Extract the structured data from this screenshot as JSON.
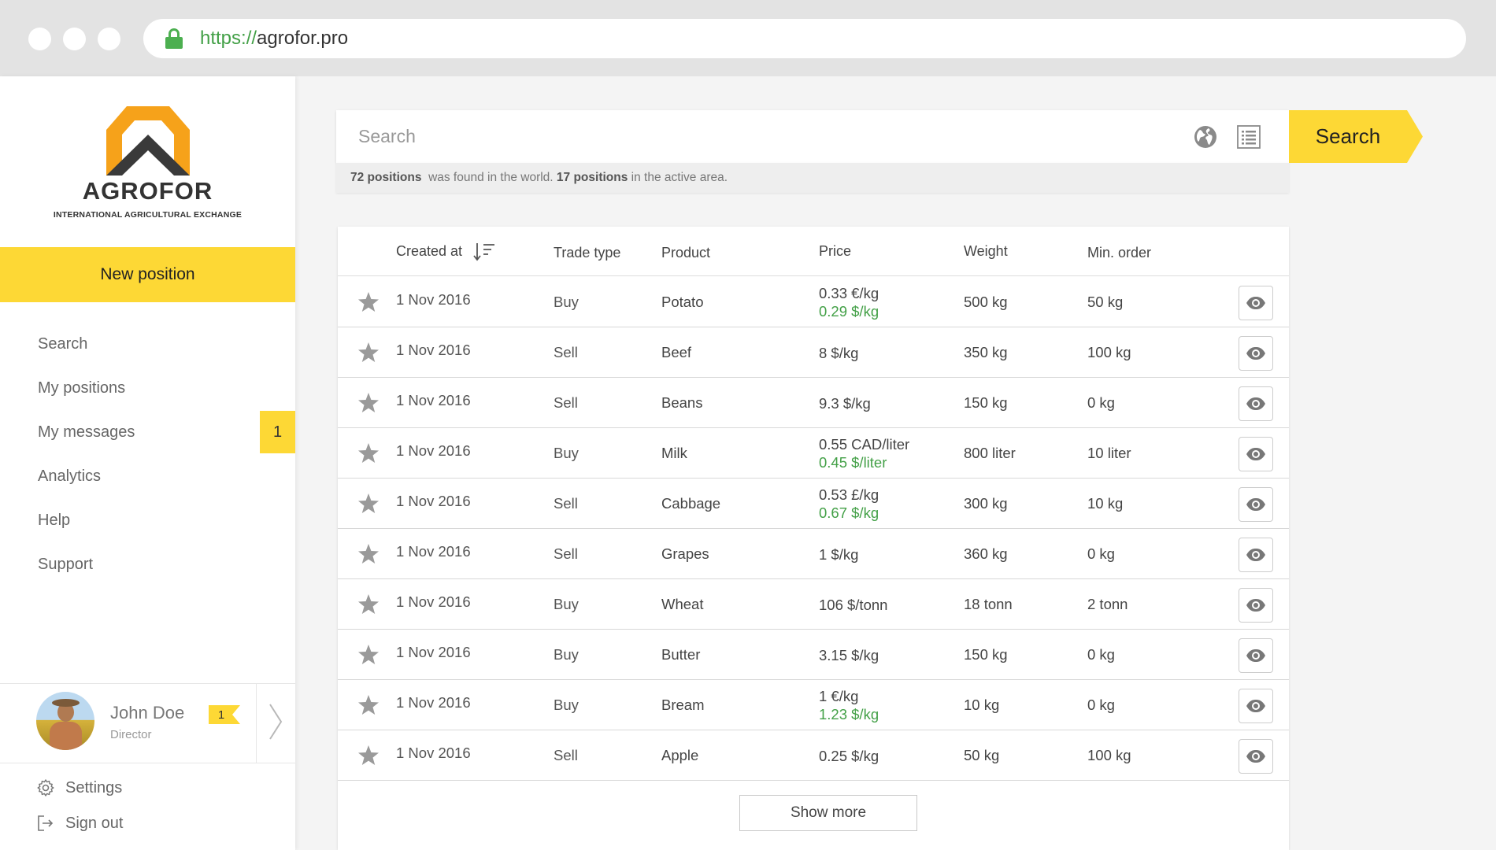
{
  "browser": {
    "url_protocol": "https://",
    "url_host": "agrofor.pro"
  },
  "sidebar": {
    "logo_name": "AGROFOR",
    "logo_tagline": "INTERNATIONAL AGRICULTURAL EXCHANGE",
    "new_position_label": "New position",
    "nav": [
      {
        "label": "Search"
      },
      {
        "label": "My positions"
      },
      {
        "label": "My messages",
        "badge": "1"
      },
      {
        "label": "Analytics"
      },
      {
        "label": "Help"
      },
      {
        "label": "Support"
      }
    ],
    "profile": {
      "name": "John Doe",
      "role": "Director",
      "badge": "1"
    },
    "settings_label": "Settings",
    "signout_label": "Sign out"
  },
  "search": {
    "placeholder": "Search",
    "button_label": "Search",
    "found_count_world": "72 positions",
    "found_text_1": "was found in the world.",
    "found_count_active": "17 positions",
    "found_text_2": "in the active area."
  },
  "table": {
    "columns": {
      "created": "Created at",
      "trade_type": "Trade type",
      "product": "Product",
      "price": "Price",
      "weight": "Weight",
      "min_order": "Min. order"
    },
    "rows": [
      {
        "date": "1 Nov 2016",
        "type": "Buy",
        "product": "Potato",
        "price": "0.33 €/kg",
        "price_usd": "0.29 $/kg",
        "weight": "500 kg",
        "min_order": "50 kg"
      },
      {
        "date": "1 Nov 2016",
        "type": "Sell",
        "product": "Beef",
        "price": "8 $/kg",
        "price_usd": "",
        "weight": "350 kg",
        "min_order": "100 kg"
      },
      {
        "date": "1 Nov 2016",
        "type": "Sell",
        "product": "Beans",
        "price": "9.3 $/kg",
        "price_usd": "",
        "weight": "150 kg",
        "min_order": "0 kg"
      },
      {
        "date": "1 Nov 2016",
        "type": "Buy",
        "product": "Milk",
        "price": "0.55 CAD/liter",
        "price_usd": "0.45 $/liter",
        "weight": "800 liter",
        "min_order": "10 liter"
      },
      {
        "date": "1 Nov 2016",
        "type": "Sell",
        "product": "Cabbage",
        "price": "0.53 £/kg",
        "price_usd": "0.67 $/kg",
        "weight": "300 kg",
        "min_order": "10 kg"
      },
      {
        "date": "1 Nov 2016",
        "type": "Sell",
        "product": "Grapes",
        "price": "1 $/kg",
        "price_usd": "",
        "weight": "360 kg",
        "min_order": "0 kg"
      },
      {
        "date": "1 Nov 2016",
        "type": "Buy",
        "product": "Wheat",
        "price": "106 $/tonn",
        "price_usd": "",
        "weight": "18 tonn",
        "min_order": "2 tonn"
      },
      {
        "date": "1 Nov 2016",
        "type": "Buy",
        "product": "Butter",
        "price": "3.15 $/kg",
        "price_usd": "",
        "weight": "150 kg",
        "min_order": "0 kg"
      },
      {
        "date": "1 Nov 2016",
        "type": "Buy",
        "product": "Bream",
        "price": "1 €/kg",
        "price_usd": "1.23 $/kg",
        "weight": "10 kg",
        "min_order": "0 kg"
      },
      {
        "date": "1 Nov 2016",
        "type": "Sell",
        "product": "Apple",
        "price": "0.25 $/kg",
        "price_usd": "",
        "weight": "50 kg",
        "min_order": "100 kg"
      }
    ],
    "show_more_label": "Show more"
  },
  "colors": {
    "accent": "#fdd835",
    "logo_orange": "#f6a21a",
    "logo_dark": "#3a3a3a",
    "price_green": "#43a047",
    "icon_gray": "#8a8a8a"
  },
  "icons": {
    "lock": "lock-icon",
    "globe": "globe-icon",
    "list": "list-icon",
    "sort": "sort-descending-icon",
    "star": "star-icon",
    "eye": "eye-icon",
    "gear": "gear-icon",
    "signout": "sign-out-icon",
    "chevron": "chevron-right-icon"
  }
}
